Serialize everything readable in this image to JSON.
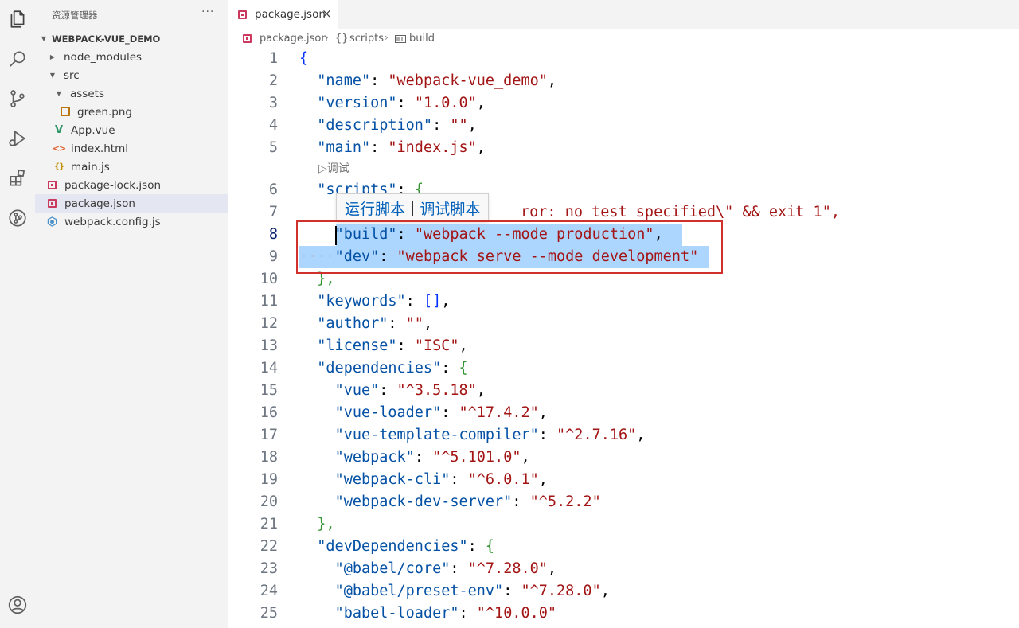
{
  "activity_bar": {
    "icons": [
      "explorer-icon",
      "search-icon",
      "source-control-icon",
      "run-debug-icon",
      "extensions-icon",
      "git-graph-icon",
      "account-icon"
    ]
  },
  "sidebar": {
    "title": "资源管理器",
    "more": "···",
    "root": "WEBPACK-VUE_DEMO",
    "items": [
      {
        "label": "node_modules",
        "icon": "folder-collapsed"
      },
      {
        "label": "src",
        "icon": "folder-expanded"
      },
      {
        "label": "assets",
        "icon": "folder-expanded"
      },
      {
        "label": "green.png",
        "icon": "image-file"
      },
      {
        "label": "App.vue",
        "icon": "vue-file"
      },
      {
        "label": "index.html",
        "icon": "html-file"
      },
      {
        "label": "main.js",
        "icon": "js-file"
      },
      {
        "label": "package-lock.json",
        "icon": "json-file"
      },
      {
        "label": "package.json",
        "icon": "json-file"
      },
      {
        "label": "webpack.config.js",
        "icon": "webpack-file"
      }
    ]
  },
  "tab": {
    "label": "package.json",
    "close": "×"
  },
  "breadcrumb": {
    "file": "package.json",
    "scripts": "scripts",
    "scripts_icon": "{}",
    "build": "build"
  },
  "codelens": {
    "debug": "▷调试"
  },
  "hover_lens": {
    "run": "运行脚本",
    "sep": "|",
    "debug": "调试脚本"
  },
  "editor": {
    "line_numbers": [
      "1",
      "2",
      "3",
      "4",
      "5",
      "6",
      "7",
      "8",
      "9",
      "10",
      "11",
      "12",
      "13",
      "14",
      "15",
      "16",
      "17",
      "18",
      "19",
      "20",
      "21",
      "22",
      "23",
      "24",
      "25"
    ],
    "line7_visible": "ror: no test specified\\\" && exit 1\",",
    "lines": {
      "l1": "{",
      "l2_key": "\"name\"",
      "l2_val": "\"webpack-vue_demo\"",
      "l3_key": "\"version\"",
      "l3_val": "\"1.0.0\"",
      "l4_key": "\"description\"",
      "l4_val": "\"\"",
      "l5_key": "\"main\"",
      "l5_val": "\"index.js\"",
      "l6_key": "\"scripts\"",
      "l6_brace": "{",
      "l8_key": "\"build\"",
      "l8_val": "\"webpack --mode production\"",
      "l9_key": "\"dev\"",
      "l9_val": "\"webpack serve --mode development\"",
      "l10": "},",
      "l11_key": "\"keywords\"",
      "l11_val": "[]",
      "l12_key": "\"author\"",
      "l12_val": "\"\"",
      "l13_key": "\"license\"",
      "l13_val": "\"ISC\"",
      "l14_key": "\"dependencies\"",
      "l14_brace": "{",
      "l15_key": "\"vue\"",
      "l15_val": "\"^3.5.18\"",
      "l16_key": "\"vue-loader\"",
      "l16_val": "\"^17.4.2\"",
      "l17_key": "\"vue-template-compiler\"",
      "l17_val": "\"^2.7.16\"",
      "l18_key": "\"webpack\"",
      "l18_val": "\"^5.101.0\"",
      "l19_key": "\"webpack-cli\"",
      "l19_val": "\"^6.0.1\"",
      "l20_key": "\"webpack-dev-server\"",
      "l20_val": "\"^5.2.2\"",
      "l21": "},",
      "l22_key": "\"devDependencies\"",
      "l22_brace": "{",
      "l23_key": "\"@babel/core\"",
      "l23_val": "\"^7.28.0\"",
      "l24_key": "\"@babel/preset-env\"",
      "l24_val": "\"^7.28.0\"",
      "l25_key": "\"babel-loader\"",
      "l25_val": "\"^10.0.0\""
    }
  },
  "colors": {
    "highlight_box": "#d0312d",
    "selection": "#add6ff",
    "key": "#0451a5",
    "string": "#a31515"
  }
}
